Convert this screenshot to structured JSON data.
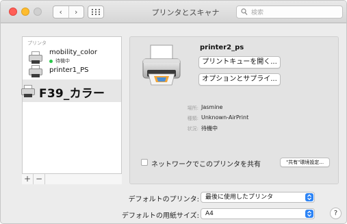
{
  "window": {
    "title": "プリンタとスキャナ",
    "search_placeholder": "検索"
  },
  "nav": {
    "back": "‹",
    "forward": "›"
  },
  "sidebar": {
    "header": "プリンタ",
    "items": [
      {
        "name": "mobility_color",
        "status": "待機中"
      },
      {
        "name": "printer1_PS"
      },
      {
        "name": "F39_カラー"
      }
    ],
    "add": "+",
    "remove": "−"
  },
  "detail": {
    "printer_name": "printer2_ps",
    "open_queue": "プリントキューを開く...",
    "options": "オプションとサプライ...",
    "location_label": "場所:",
    "location": "Jasmine",
    "kind_label": "種類:",
    "kind": "Unknown-AirPrint",
    "status_label": "状況:",
    "status": "待機中",
    "share_label": "ネットワークでこのプリンタを共有",
    "sharing_prefs": "\"共有\"環境設定..."
  },
  "settings": {
    "default_printer_label": "デフォルトのプリンタ:",
    "default_printer_value": "最後に使用したプリンタ",
    "paper_size_label": "デフォルトの用紙サイズ:",
    "paper_size_value": "A4",
    "help": "?"
  },
  "colors": {
    "accent": "#2d84f5",
    "status_idle": "#2ac84a"
  }
}
